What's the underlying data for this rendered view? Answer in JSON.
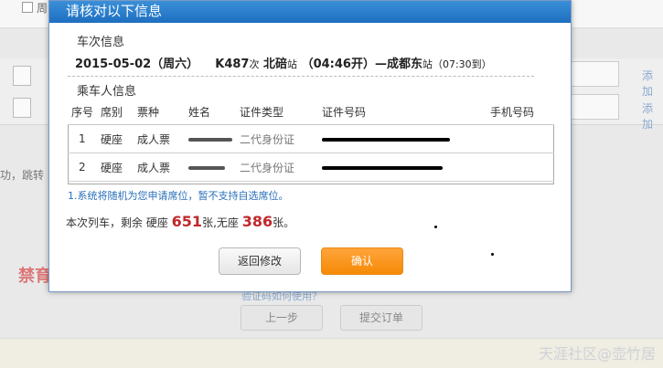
{
  "modal": {
    "title": "请核对以下信息",
    "train_section_title": "车次信息",
    "trip": {
      "date": "2015-05-02（周六）",
      "train_no": "K487",
      "train_suffix": "次",
      "from_station": "北碚",
      "from_suffix": "站",
      "depart": "（04:46开）",
      "arrow": "—",
      "to_station": "成都东",
      "to_suffix": "站",
      "arrive": "（07:30到）"
    },
    "passenger_section_title": "乘车人信息",
    "table": {
      "headers": [
        "序号",
        "席别",
        "票种",
        "姓名",
        "证件类型",
        "证件号码",
        "手机号码"
      ],
      "rows": [
        {
          "no": "1",
          "seat": "硬座",
          "ticket": "成人票",
          "id_type": "二代身份证"
        },
        {
          "no": "2",
          "seat": "硬座",
          "ticket": "成人票",
          "id_type": "二代身份证"
        }
      ]
    },
    "note": "1.系统将随机为您申请席位，暂不支持自选席位。",
    "remaining": {
      "prefix": "本次列车，剩余 硬座",
      "hard_seat": "651",
      "middle": "张,无座",
      "no_seat": "386",
      "suffix": "张。"
    },
    "back_button": "返回修改",
    "confirm_button": "确认"
  },
  "background": {
    "top_checkbox_label": "周",
    "add_link_1": "添加",
    "add_link_2": "添加",
    "partial_text": "功，跳转",
    "logo_text": "禁育",
    "prev_button": "上一步",
    "submit_button": "提交订单",
    "verify_text": "验证码如何使用？"
  },
  "watermark": "天涯社区@壶竹居"
}
